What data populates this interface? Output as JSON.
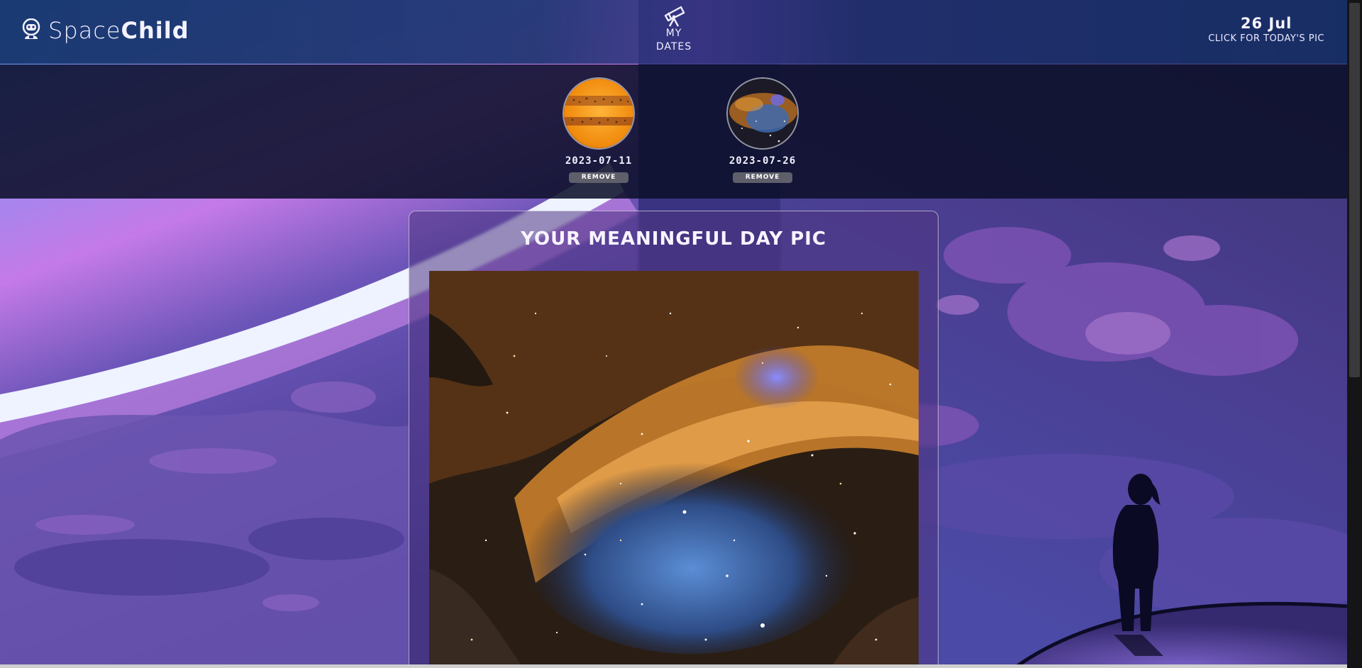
{
  "header": {
    "logo_text_light": "Space",
    "logo_text_bold": "Child",
    "logo_icon": "astronaut-icon",
    "nav_icon": "telescope-icon",
    "nav_line1": "MY",
    "nav_line2": "DATES",
    "today_date": "26 Jul",
    "today_cta": "CLICK FOR TODAY'S PIC"
  },
  "saved_dates": [
    {
      "date": "2023-07-11",
      "remove_label": "REMOVE",
      "thumb": "jupiter-thumbnail"
    },
    {
      "date": "2023-07-26",
      "remove_label": "REMOVE",
      "thumb": "nebula-thumbnail"
    }
  ],
  "main": {
    "title": "YOUR MEANINGFUL DAY PIC",
    "image": "nebula-photo"
  },
  "colors": {
    "header_bg": "#1b3a72",
    "dates_bar_bg": "#0d102a",
    "remove_button": "#5e5f6a",
    "text": "#f3f0ff"
  }
}
